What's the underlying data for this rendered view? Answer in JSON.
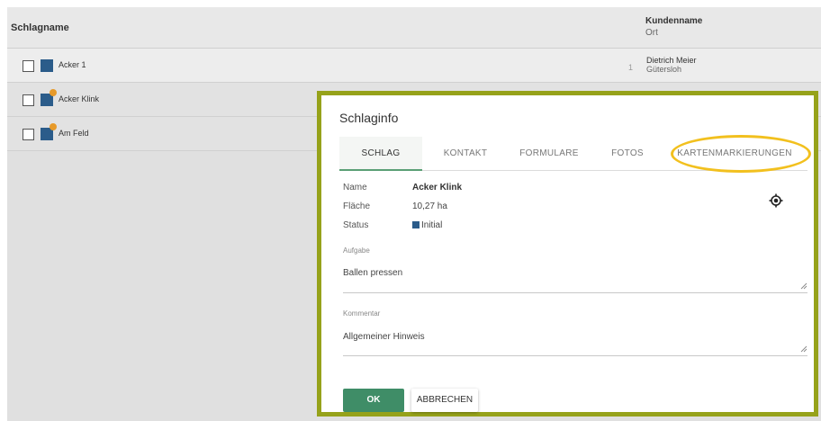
{
  "table": {
    "header": {
      "col_name": "Schlagname",
      "col_customer": "Kundenname",
      "col_customer_sub": "Ort"
    },
    "rows": [
      {
        "name": "Acker 1",
        "num": "1",
        "customer": "Dietrich Meier",
        "city": "Gütersloh"
      },
      {
        "name": "Acker Klink",
        "num": "",
        "customer": "",
        "city": ""
      },
      {
        "name": "Am Feld",
        "num": "",
        "customer": "",
        "city": ""
      }
    ]
  },
  "modal": {
    "title": "Schlaginfo",
    "tabs": [
      "SCHLAG",
      "KONTAKT",
      "FORMULARE",
      "FOTOS",
      "KARTENMARKIERUNGEN"
    ],
    "fields": {
      "name_label": "Name",
      "name_value": "Acker Klink",
      "area_label": "Fläche",
      "area_value": "10,27 ha",
      "status_label": "Status",
      "status_value": "Initial"
    },
    "task": {
      "label": "Aufgabe",
      "value": "Ballen pressen"
    },
    "comment": {
      "label": "Kommentar",
      "value": "Allgemeiner Hinweis"
    },
    "buttons": {
      "ok": "OK",
      "cancel": "ABBRECHEN"
    }
  },
  "colors": {
    "frame": "#96a21a",
    "highlight": "#f2c01e",
    "ok": "#3f8d67",
    "status": "#2b5c8a",
    "badge": "#e79a2a"
  },
  "icons": {
    "target": "target-icon",
    "resize": "resize-handle-icon"
  }
}
